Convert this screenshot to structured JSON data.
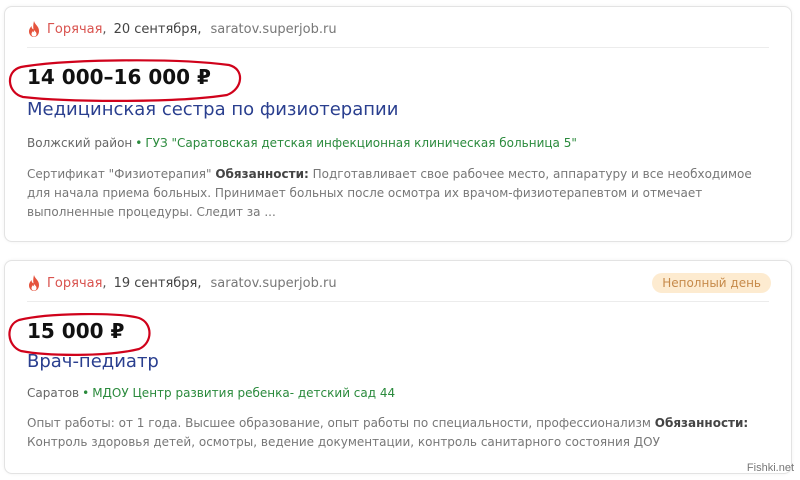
{
  "vacancies": [
    {
      "hot_label": "Горячая",
      "date": "20 сентября,",
      "source": "saratov.superjob.ru",
      "salary": "14 000–16 000 ₽",
      "title": "Медицинская сестра по физиотерапии",
      "area": "Волжский район",
      "org": "ГУЗ \"Саратовская детская инфекционная клиническая больница 5\"",
      "desc_prefix": "Сертификат \"Физиотерапия\" ",
      "desc_bold": "Обязанности:",
      "desc_text": " Подготавливает свое рабочее место, аппаратуру и все необходимое для начала приема больных. Принимает больных после осмотра их врачом-физиотерапевтом и отмечает выполненные процедуры. Следит за ..."
    },
    {
      "hot_label": "Горячая",
      "date": "19 сентября,",
      "source": "saratov.superjob.ru",
      "badge": "Неполный день",
      "salary": "15 000 ₽",
      "title": "Врач-педиатр",
      "area": "Саратов",
      "org": "МДОУ Центр развития ребенка- детский сад 44",
      "desc_prefix": "Опыт работы: от 1 года. Высшее образование, опыт работы по специальности, профессионализм ",
      "desc_bold": "Обязанности:",
      "desc_text": " Контроль здоровья детей, осмотры, ведение документации, контроль санитарного состояния ДОУ"
    }
  ],
  "watermark": "Fishki.net",
  "icons": {
    "hot": "flame-icon"
  },
  "colors": {
    "hot": "#d9534f",
    "title_link": "#2a3f8f",
    "org_link": "#2a8a3c",
    "annotation": "#d0021b"
  }
}
